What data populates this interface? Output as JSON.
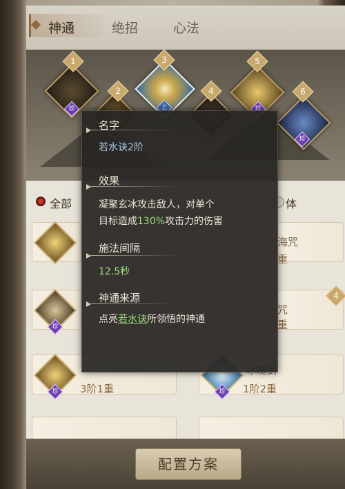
{
  "tabs": [
    {
      "label": "神通",
      "active": true
    },
    {
      "label": "绝招",
      "active": false
    },
    {
      "label": "心法",
      "active": false
    }
  ],
  "skills": [
    {
      "number": "1",
      "badge": "珍",
      "icon": "dark-crane-skill-icon"
    },
    {
      "number": "2",
      "badge": "",
      "icon": "golden-crane-skill-icon"
    },
    {
      "number": "3",
      "badge": "上",
      "icon": "swirl-skill-icon",
      "selected": true
    },
    {
      "number": "4",
      "badge": "",
      "icon": "dark-mountain-skill-icon"
    },
    {
      "number": "5",
      "badge": "珍",
      "icon": "golden-burst-skill-icon"
    },
    {
      "number": "6",
      "badge": "珍",
      "icon": "blue-spirit-skill-icon"
    }
  ],
  "filters": [
    {
      "label": "全部",
      "selected": true
    },
    {
      "label": "体",
      "selected": false
    }
  ],
  "cards": [
    {
      "name": "沙海咒",
      "level": "重"
    },
    {
      "name": "玄冰咒",
      "level": "重"
    },
    {
      "name": "",
      "level": "3阶1重"
    },
    {
      "name": "冰魄剑",
      "level": "1阶2重"
    }
  ],
  "tooltip": {
    "name_header": "名字",
    "name_value": "若水诀2阶",
    "effect_header": "效果",
    "effect_line1": "凝聚玄冰攻击敌人，对单个",
    "effect_line2_prefix": "目标造成",
    "effect_line2_highlight": "130%",
    "effect_line2_suffix": "攻击力的伤害",
    "interval_header": "施法间隔",
    "interval_value": "12.5秒",
    "source_header": "神通来源",
    "source_prefix": "点亮",
    "source_link": "若水诀",
    "source_suffix": "所领悟的神通"
  },
  "config_button": "配置方案",
  "colors": {
    "accent_gold": "#c9a86c",
    "rarity_purple": "#6d3fb4",
    "highlight_green": "#9be07a",
    "value_blue": "#a8c8e6"
  }
}
